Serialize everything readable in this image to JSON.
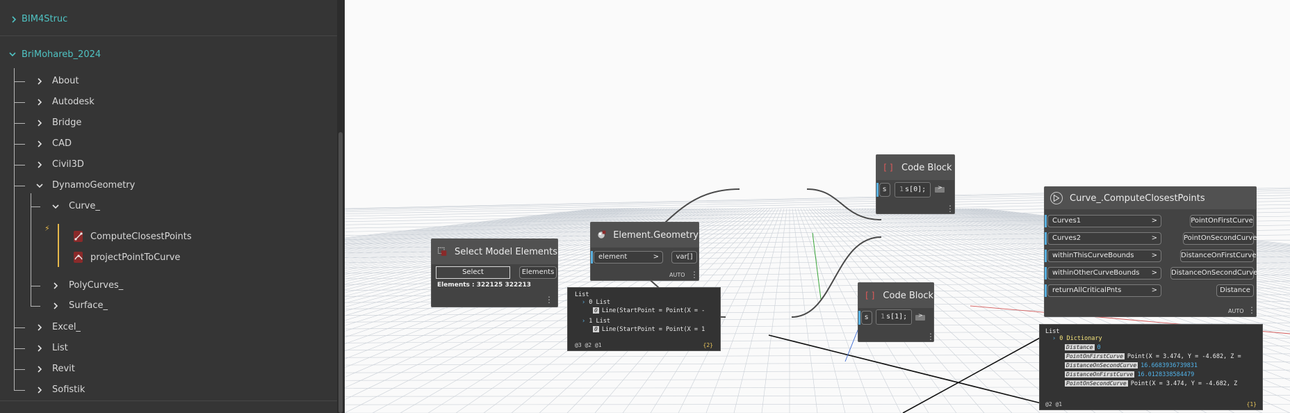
{
  "library": {
    "groups": [
      {
        "label": "BIM4Struc",
        "expanded": false
      },
      {
        "label": "BriMohareb_2024",
        "expanded": true
      }
    ],
    "categories": [
      "About",
      "Autodesk",
      "Bridge",
      "CAD",
      "Civil3D",
      "DynamoGeometry",
      "Excel_",
      "List",
      "Revit",
      "Sofistik"
    ],
    "subcategories": [
      "Curve_",
      "PolyCurves_",
      "Surface_"
    ],
    "nodes": [
      "ComputeClosestPoints",
      "projectPointToCurve"
    ]
  },
  "nodes": {
    "select_model": {
      "title": "Select Model Elements",
      "button": "Select",
      "output": "Elements",
      "info": "Elements : 322125 322213"
    },
    "element_geometry": {
      "title": "Element.Geometry",
      "input": "element",
      "output": "var[]",
      "lacing": "AUTO"
    },
    "code_block_1": {
      "title": "Code Block",
      "input": "s",
      "line_no": "1",
      "code": "s[0];"
    },
    "code_block_2": {
      "title": "Code Block",
      "input": "s",
      "line_no": "1",
      "code": "s[1];"
    },
    "compute_closest": {
      "title": "Curve_.ComputeClosestPoints",
      "inputs": [
        "Curves1",
        "Curves2",
        "withinThisCurveBounds",
        "withinOtherCurveBounds",
        "returnAllCriticalPnts"
      ],
      "outputs": [
        "PointOnFirstCurve",
        "PointOnSecondCurve",
        "DistanceOnFirstCurve",
        "DistanceOnSecondCurve",
        "Distance"
      ],
      "lacing": "AUTO"
    }
  },
  "previews": {
    "geometry": {
      "header": "List",
      "lines": [
        {
          "idx": "",
          "text": "0 List"
        },
        {
          "idx": "0",
          "text": "Line(StartPoint = Point(X = -"
        },
        {
          "idx": "",
          "text": "1 List"
        },
        {
          "idx": "0",
          "text": "Line(StartPoint = Point(X = 1"
        }
      ],
      "levels": "@3 @2 @1",
      "count": "{2}"
    },
    "closest": {
      "header": "List",
      "dict_label": "0 Dictionary",
      "entries": [
        {
          "key": "Distance",
          "value": "0"
        },
        {
          "key": "PointOnFirstCurve",
          "value": "Point(X = 3.474, Y = -4.682, Z ="
        },
        {
          "key": "DistanceOnSecondCurve",
          "value": "16.6683936739831"
        },
        {
          "key": "DistanceOnFirstCurve",
          "value": "16.0128338584479"
        },
        {
          "key": "PointOnSecondCurve",
          "value": "Point(X = 3.474, Y = -4.682, Z"
        }
      ],
      "levels": "@2 @1",
      "count": "{1}"
    }
  },
  "colors": {
    "panel": "#353535",
    "library_group": "#4fc2c2",
    "node_body": "#434343",
    "node_header": "#515151",
    "input_bar": "#5ab0df",
    "wire": "#4a4a4a",
    "accent_line": "#e6b84a"
  }
}
